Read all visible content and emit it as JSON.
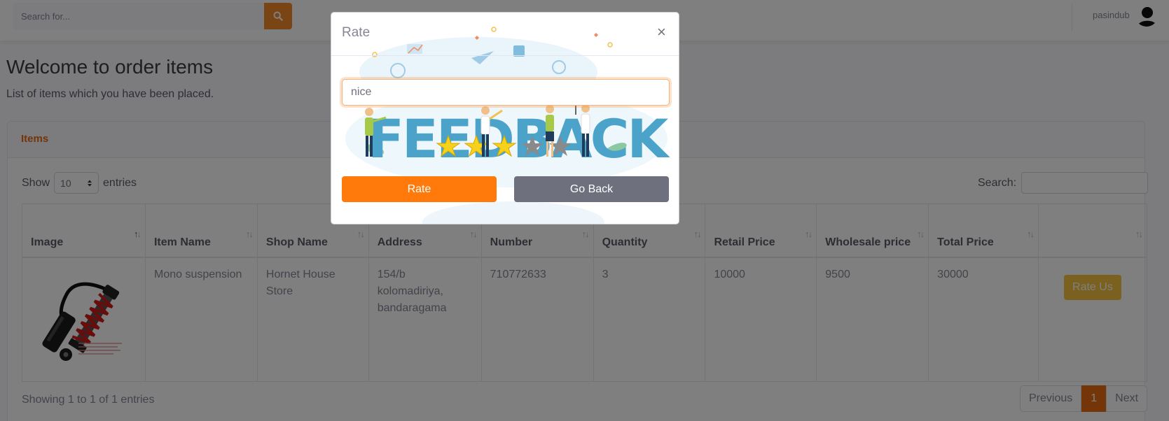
{
  "topbar": {
    "search_placeholder": "Search for...",
    "user_name": "pasindub"
  },
  "page": {
    "title": "Welcome to order items",
    "subtitle": "List of items which you have been placed."
  },
  "card": {
    "header": "Items",
    "length_prefix": "Show",
    "length_value": "10",
    "length_suffix": "entries",
    "search_label": "Search:",
    "columns": [
      "Image",
      "Item Name",
      "Shop Name",
      "Address",
      "Number",
      "Quantity",
      "Retail Price",
      "Wholesale price",
      "Total Price",
      ""
    ],
    "rows": [
      {
        "item_name": "Mono suspension",
        "shop_name": "Hornet House Store",
        "address": "154/b kolomadiriya, bandaragama",
        "number": "710772633",
        "quantity": "3",
        "retail_price": "10000",
        "wholesale_price": "9500",
        "total_price": "30000",
        "action_label": "Rate Us"
      }
    ],
    "info": "Showing 1 to 1 of 1 entries",
    "pager": {
      "prev": "Previous",
      "current": "1",
      "next": "Next"
    }
  },
  "modal": {
    "title": "Rate",
    "close": "×",
    "input_value": "nice",
    "image_text": "FEEDBACK",
    "rate_button": "Rate",
    "back_button": "Go Back",
    "stars_filled": 3,
    "stars_total": 5
  },
  "colors": {
    "accent": "#e86a12",
    "search_button": "#f58a2b",
    "rate_button": "#ff7a0a",
    "back_button": "#6e707e",
    "rate_us_button": "#f6c23e"
  }
}
